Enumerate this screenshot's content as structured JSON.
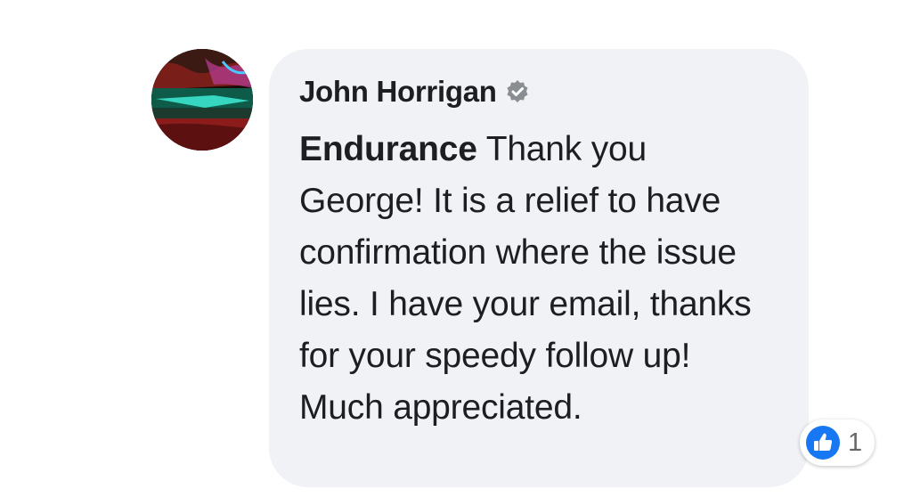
{
  "comment": {
    "author": "John Horrigan",
    "mention": "Endurance",
    "text": " Thank you George!  It is a relief to have confirmation where the issue lies.  I have your email, thanks for your speedy follow up!  Much appreciated.",
    "reactions": {
      "type": "like",
      "count": "1"
    }
  },
  "colors": {
    "bubble": "#f0f2f5",
    "text": "#1c1e21",
    "like_blue": "#1877f2",
    "verified_gray": "#8a8d91"
  },
  "icons": {
    "verified": "verified-badge-icon",
    "like": "thumbs-up-icon"
  }
}
